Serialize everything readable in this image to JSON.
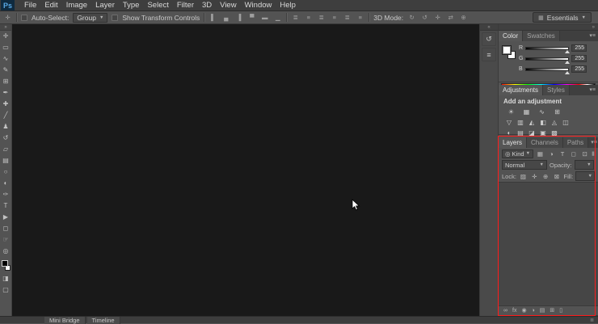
{
  "window": {
    "logo": "Ps",
    "workspace": "Essentials",
    "workspace_icon": "▦"
  },
  "menu": {
    "items": [
      "File",
      "Edit",
      "Image",
      "Layer",
      "Type",
      "Select",
      "Filter",
      "3D",
      "View",
      "Window",
      "Help"
    ]
  },
  "options": {
    "tool_glyph": "✛",
    "auto_select_label": "Auto-Select:",
    "group_value": "Group",
    "show_transform_label": "Show Transform Controls",
    "mode_label": "3D Mode:",
    "align_icons": [
      "▌",
      "▄",
      "▐",
      "▀",
      "▬",
      "▁"
    ],
    "distribute_icons": [
      "≣",
      "≡",
      "≣",
      "≡",
      "≣",
      "≡"
    ],
    "mode_icons": [
      "↻",
      "↺",
      "✛",
      "⇄",
      "⊕"
    ]
  },
  "toolbar": {
    "collapse_glyph": "»",
    "tools": [
      {
        "name": "move",
        "glyph": "✛"
      },
      {
        "name": "marquee",
        "glyph": "▭"
      },
      {
        "name": "lasso",
        "glyph": "∿"
      },
      {
        "name": "quick-selection",
        "glyph": "✎"
      },
      {
        "name": "crop",
        "glyph": "⊞"
      },
      {
        "name": "eyedropper",
        "glyph": "✒"
      },
      {
        "name": "healing-brush",
        "glyph": "✚"
      },
      {
        "name": "brush",
        "glyph": "╱"
      },
      {
        "name": "clone-stamp",
        "glyph": "♟"
      },
      {
        "name": "history-brush",
        "glyph": "↺"
      },
      {
        "name": "eraser",
        "glyph": "▱"
      },
      {
        "name": "gradient",
        "glyph": "▤"
      },
      {
        "name": "blur",
        "glyph": "○"
      },
      {
        "name": "dodge",
        "glyph": "◐"
      },
      {
        "name": "pen",
        "glyph": "✑"
      },
      {
        "name": "type",
        "glyph": "T"
      },
      {
        "name": "path-selection",
        "glyph": "▶"
      },
      {
        "name": "shape",
        "glyph": "◻"
      },
      {
        "name": "hand",
        "glyph": "☞"
      },
      {
        "name": "zoom",
        "glyph": "◎"
      }
    ],
    "quick_mask_glyph": "◨",
    "screen_mode_glyph": "▢"
  },
  "dock": {
    "collapse_glyph": "«",
    "icons": [
      {
        "name": "history-panel",
        "glyph": "↺"
      },
      {
        "name": "properties-panel",
        "glyph": "≡"
      }
    ]
  },
  "color_panel": {
    "tabs": [
      "Color",
      "Swatches"
    ],
    "menu_glyph": "▾≡",
    "channels": [
      {
        "label": "R",
        "value": "255"
      },
      {
        "label": "G",
        "value": "255"
      },
      {
        "label": "B",
        "value": "255"
      }
    ]
  },
  "adjustments_panel": {
    "tabs": [
      "Adjustments",
      "Styles"
    ],
    "menu_glyph": "▾≡",
    "title": "Add an adjustment",
    "row1": [
      "☀",
      "▦",
      "∿",
      "⊞"
    ],
    "row2": [
      "▽",
      "▥",
      "◭",
      "◧",
      "◬",
      "◫"
    ],
    "row3": [
      "◐",
      "▤",
      "◪",
      "▣",
      "▩"
    ]
  },
  "layers_panel": {
    "tabs": [
      "Layers",
      "Channels",
      "Paths"
    ],
    "menu_glyph": "▾≡",
    "search_glyph": "◎",
    "kind_value": "Kind",
    "dd_arrow": "▾",
    "filter_icons": [
      "▦",
      "◑",
      "T",
      "◻",
      "⊡"
    ],
    "toggle_glyph": "▮",
    "blend_mode": "Normal",
    "opacity_label": "Opacity:",
    "opacity_value": "",
    "lock_label": "Lock:",
    "lock_icons": [
      "▨",
      "✛",
      "⊕",
      "⊠"
    ],
    "fill_label": "Fill:",
    "fill_value": "",
    "bottom_icons": [
      {
        "name": "link-layers",
        "glyph": "∞"
      },
      {
        "name": "layer-style",
        "glyph": "fx"
      },
      {
        "name": "layer-mask",
        "glyph": "◉"
      },
      {
        "name": "adjustment-layer",
        "glyph": "◑"
      },
      {
        "name": "layer-group",
        "glyph": "▤"
      },
      {
        "name": "new-layer",
        "glyph": "⊞"
      },
      {
        "name": "delete-layer",
        "glyph": "▯"
      }
    ]
  },
  "bottom_bar": {
    "tabs": [
      "Mini Bridge",
      "Timeline"
    ],
    "grip_glyph": "≣"
  },
  "annotation": {
    "color": "#ff1c1c"
  }
}
